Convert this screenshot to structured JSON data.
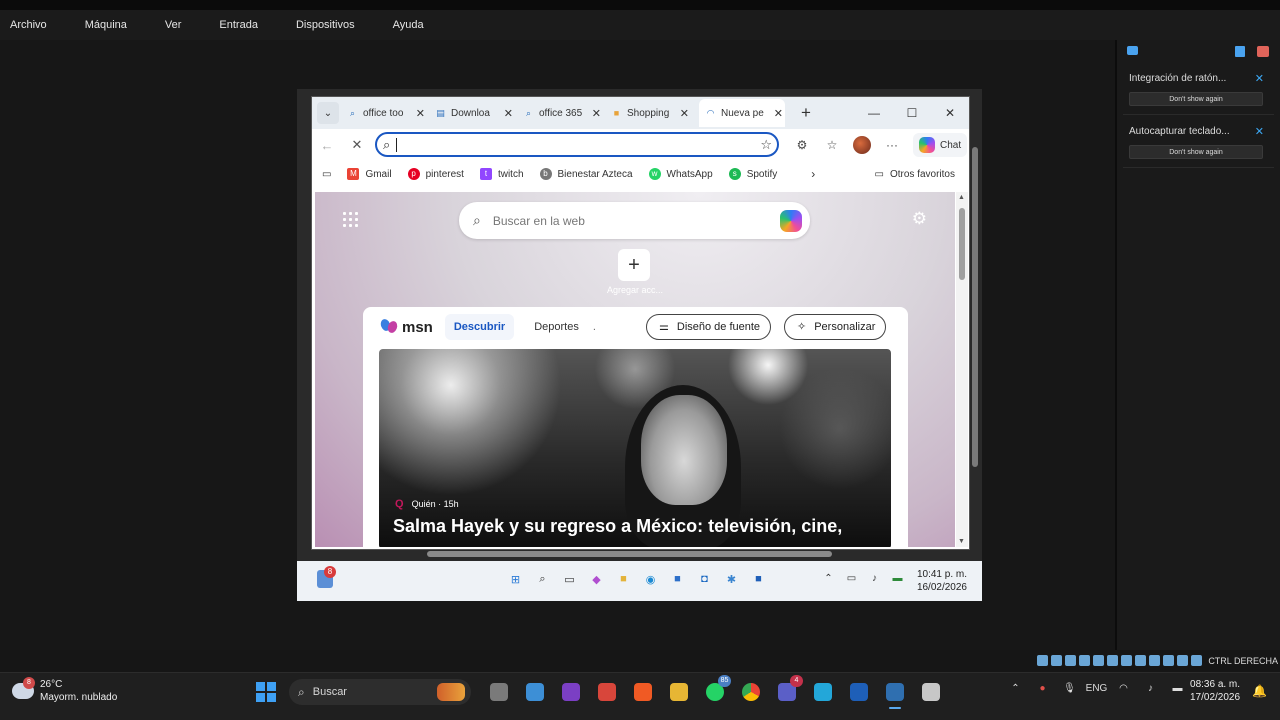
{
  "host_menu": [
    "Archivo",
    "Máquina",
    "Ver",
    "Entrada",
    "Dispositivos",
    "Ayuda"
  ],
  "side_notifications": [
    {
      "title": "Integración de ratón...",
      "button": "Don't show again"
    },
    {
      "title": "Autocapturar teclado...",
      "button": "Don't show again"
    }
  ],
  "browser": {
    "tabs": [
      {
        "label": "office too",
        "icon": "search-icon"
      },
      {
        "label": "Downloa",
        "icon": "page-icon"
      },
      {
        "label": "office 365",
        "icon": "search-icon"
      },
      {
        "label": "Shopping",
        "icon": "microsoft-icon"
      },
      {
        "label": "Nueva pe",
        "icon": "loading-icon",
        "active": true
      }
    ],
    "address_value": "",
    "chat_label": "Chat",
    "favorites": [
      {
        "label": "Gmail",
        "color": "#ea4335"
      },
      {
        "label": "pinterest",
        "color": "#e60023"
      },
      {
        "label": "twitch",
        "color": "#9146ff"
      },
      {
        "label": "Bienestar Azteca",
        "color": "#555555"
      },
      {
        "label": "WhatsApp",
        "color": "#25d366"
      },
      {
        "label": "Spotify",
        "color": "#1db954"
      }
    ],
    "other_favorites": "Otros favoritos"
  },
  "newtab": {
    "search_placeholder": "Buscar en la web",
    "add_label": "Agregar acc...",
    "msn": {
      "logo": "msn",
      "tabs": [
        "Descubrir",
        "Deportes",
        "."
      ],
      "feed_design": "Diseño de fuente",
      "personalize": "Personalizar",
      "hero": {
        "source": "Quién · 15h",
        "headline": "Salma Hayek y su regreso a México: televisión, cine,"
      }
    }
  },
  "vm_taskbar": {
    "widget_badge": "8",
    "time": "10:41 p. m.",
    "date": "16/02/2026"
  },
  "host_status": {
    "label": "CTRL DERECHA"
  },
  "host_taskbar": {
    "weather_badge": "8",
    "temperature": "26°C",
    "condition": "Mayorm. nublado",
    "search_label": "Buscar",
    "whatsapp_badge": "85",
    "teams_badge": "4",
    "lang": "ENG",
    "time": "08:36 a. m.",
    "date": "17/02/2026"
  },
  "colors": {
    "accent": "#1a57c2",
    "taskbar": "#1f1f1f",
    "windows_blue": "#3ea0f4"
  }
}
